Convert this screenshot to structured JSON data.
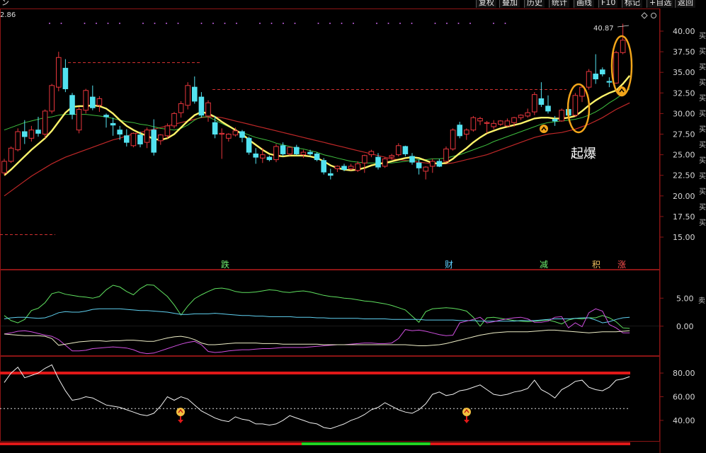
{
  "toolbar": {
    "buttons": [
      "复权",
      "叠加",
      "历史",
      "统计",
      "画线",
      "F10",
      "标记",
      "+自选",
      "返回"
    ],
    "corner_icon": "diamond-icon",
    "truncated_left": "ン"
  },
  "price_readout": "2.86",
  "main_chart": {
    "y_ticks": [
      "40.00",
      "37.50",
      "35.00",
      "32.50",
      "30.00",
      "27.50",
      "25.00",
      "22.50",
      "20.00",
      "17.50",
      "15.00"
    ],
    "high_label": "40.87",
    "annotation": "起爆",
    "signal_labels": [
      {
        "text": "跌",
        "color": "#6fef6f"
      },
      {
        "text": "财",
        "color": "#5fd0ff"
      },
      {
        "text": "减",
        "color": "#6fef6f"
      },
      {
        "text": "积",
        "color": "#f0c060"
      },
      {
        "text": "涨",
        "color": "#ff5050"
      }
    ],
    "right_strip_text": "买买买买买买买买买买买买买"
  },
  "indicator1": {
    "y_ticks": [
      "5.00",
      "0.00"
    ],
    "side_text": "卖"
  },
  "indicator2": {
    "y_ticks": [
      "80.00",
      "60.00",
      "40.00"
    ]
  },
  "colors": {
    "up": "#e8363c",
    "down": "#53e2f0",
    "ma_yellow": "#fff46a",
    "ma_green": "#3fbf3f",
    "ma_red": "#c02828",
    "orange": "#f2a51a",
    "grid": "#8b1515",
    "tick_text": "#d8d8d8"
  },
  "chart_data": {
    "type": "candlestick",
    "y_range": [
      13,
      42
    ],
    "candles": [
      [
        22.8,
        24.5,
        22.5,
        24.2
      ],
      [
        24.2,
        26.0,
        24.0,
        25.8
      ],
      [
        25.6,
        28.2,
        25.4,
        27.8
      ],
      [
        27.8,
        29.2,
        26.3,
        27.2
      ],
      [
        27.0,
        28.5,
        26.6,
        28.0
      ],
      [
        28.0,
        29.6,
        27.2,
        27.6
      ],
      [
        27.5,
        30.5,
        27.0,
        30.3
      ],
      [
        30.3,
        33.6,
        30.0,
        33.4
      ],
      [
        33.2,
        37.5,
        32.7,
        36.8
      ],
      [
        35.5,
        36.6,
        32.6,
        33.0
      ],
      [
        32.2,
        32.5,
        29.3,
        29.9
      ],
      [
        28.0,
        30.8,
        27.6,
        30.5
      ],
      [
        30.4,
        33.0,
        30.0,
        32.8
      ],
      [
        32.0,
        33.4,
        30.4,
        30.7
      ],
      [
        31.0,
        32.1,
        30.2,
        31.8
      ],
      [
        29.8,
        30.0,
        28.3,
        29.6
      ],
      [
        28.8,
        29.5,
        27.3,
        28.6
      ],
      [
        28.0,
        28.5,
        26.8,
        27.5
      ],
      [
        27.3,
        28.1,
        26.0,
        26.5
      ],
      [
        26.1,
        27.7,
        25.9,
        27.6
      ],
      [
        27.4,
        27.8,
        25.9,
        26.3
      ],
      [
        26.5,
        28.3,
        25.8,
        28.0
      ],
      [
        28.0,
        29.3,
        24.9,
        25.3
      ],
      [
        26.7,
        27.5,
        26.2,
        27.4
      ],
      [
        27.3,
        28.8,
        27.0,
        28.5
      ],
      [
        28.5,
        30.2,
        28.2,
        30.0
      ],
      [
        30.1,
        31.5,
        29.5,
        31.2
      ],
      [
        31.0,
        33.8,
        30.5,
        33.4
      ],
      [
        33.2,
        34.5,
        31.2,
        31.5
      ],
      [
        32.0,
        32.6,
        29.5,
        29.8
      ],
      [
        29.7,
        31.6,
        29.0,
        31.3
      ],
      [
        28.9,
        29.7,
        27.0,
        27.5
      ],
      [
        27.5,
        28.2,
        24.5,
        27.6
      ],
      [
        27.0,
        27.6,
        26.6,
        27.5
      ],
      [
        27.4,
        28.3,
        27.2,
        27.9
      ],
      [
        27.8,
        28.0,
        26.5,
        27.1
      ],
      [
        27.0,
        27.2,
        25.0,
        25.3
      ],
      [
        25.1,
        25.8,
        23.9,
        24.7
      ],
      [
        24.6,
        25.8,
        24.0,
        25.0
      ],
      [
        24.7,
        24.9,
        24.2,
        24.4
      ],
      [
        24.4,
        26.3,
        24.1,
        26.0
      ],
      [
        26.1,
        26.5,
        24.8,
        25.1
      ],
      [
        25.1,
        26.0,
        24.9,
        25.9
      ],
      [
        25.9,
        26.2,
        24.9,
        25.1
      ],
      [
        25.0,
        25.6,
        24.6,
        25.3
      ],
      [
        25.3,
        25.6,
        24.8,
        25.1
      ],
      [
        25.1,
        25.3,
        24.2,
        24.4
      ],
      [
        24.3,
        24.6,
        22.6,
        22.9
      ],
      [
        22.7,
        23.3,
        22.0,
        22.5
      ],
      [
        23.3,
        23.7,
        22.9,
        23.6
      ],
      [
        23.6,
        23.9,
        23.0,
        23.2
      ],
      [
        23.3,
        23.9,
        23.1,
        23.6
      ],
      [
        23.1,
        24.2,
        22.9,
        23.9
      ],
      [
        24.0,
        25.0,
        22.8,
        24.9
      ],
      [
        25.0,
        25.6,
        24.7,
        25.4
      ],
      [
        24.7,
        25.2,
        23.2,
        23.5
      ],
      [
        23.6,
        24.7,
        23.4,
        24.5
      ],
      [
        24.7,
        25.1,
        24.4,
        24.9
      ],
      [
        25.0,
        26.4,
        24.8,
        26.1
      ],
      [
        26.0,
        26.1,
        24.8,
        25.1
      ],
      [
        24.8,
        25.2,
        23.8,
        24.1
      ],
      [
        24.0,
        24.4,
        22.6,
        23.4
      ],
      [
        23.0,
        23.6,
        22.0,
        23.5
      ],
      [
        23.6,
        24.5,
        22.8,
        24.2
      ],
      [
        24.2,
        24.5,
        23.5,
        23.6
      ],
      [
        24.2,
        26.0,
        24.0,
        25.7
      ],
      [
        25.7,
        28.2,
        25.5,
        28.0
      ],
      [
        28.6,
        29.0,
        27.0,
        27.3
      ],
      [
        27.5,
        28.2,
        26.8,
        28.0
      ],
      [
        28.0,
        29.7,
        27.8,
        29.5
      ],
      [
        29.1,
        29.6,
        28.6,
        29.4
      ],
      [
        28.8,
        29.1,
        27.6,
        28.9
      ],
      [
        28.4,
        29.2,
        28.1,
        28.8
      ],
      [
        28.7,
        29.2,
        28.5,
        29.1
      ],
      [
        28.5,
        29.4,
        28.4,
        29.1
      ],
      [
        28.9,
        29.6,
        28.4,
        29.5
      ],
      [
        29.5,
        29.9,
        29.2,
        29.8
      ],
      [
        29.7,
        30.6,
        29.5,
        30.1
      ],
      [
        30.2,
        32.6,
        29.8,
        32.3
      ],
      [
        31.8,
        33.8,
        30.8,
        31.1
      ],
      [
        30.9,
        32.2,
        30.0,
        30.3
      ],
      [
        29.3,
        29.7,
        28.5,
        29.1
      ],
      [
        29.1,
        30.6,
        29.0,
        30.4
      ],
      [
        30.5,
        30.9,
        29.6,
        29.8
      ],
      [
        29.8,
        32.5,
        29.6,
        32.2
      ],
      [
        32.1,
        33.5,
        31.4,
        33.2
      ],
      [
        33.2,
        35.4,
        32.9,
        35.1
      ],
      [
        34.8,
        37.2,
        33.6,
        34.2
      ],
      [
        35.3,
        35.6,
        34.5,
        34.8
      ],
      [
        33.9,
        34.4,
        33.2,
        33.8
      ],
      [
        33.7,
        37.6,
        33.6,
        37.4
      ],
      [
        37.4,
        40.9,
        37.2,
        38.9
      ]
    ],
    "ma_fast": [
      22.5,
      23.2,
      24.0,
      24.8,
      25.6,
      26.3,
      27.0,
      27.9,
      29.0,
      30.1,
      30.8,
      30.9,
      30.9,
      31.0,
      30.9,
      30.6,
      30.0,
      29.2,
      28.5,
      28.0,
      27.6,
      27.3,
      26.9,
      26.8,
      27.0,
      27.5,
      28.3,
      29.1,
      29.8,
      30.2,
      30.0,
      29.6,
      29.0,
      28.5,
      28.0,
      27.5,
      26.8,
      26.2,
      25.6,
      25.1,
      24.9,
      24.8,
      24.9,
      24.9,
      24.9,
      24.8,
      24.6,
      24.2,
      23.7,
      23.4,
      23.2,
      23.1,
      23.2,
      23.4,
      23.7,
      23.9,
      24.0,
      24.2,
      24.4,
      24.6,
      24.7,
      24.6,
      24.3,
      24.0,
      23.9,
      24.0,
      24.5,
      25.2,
      25.8,
      26.5,
      27.1,
      27.6,
      27.9,
      28.2,
      28.4,
      28.6,
      28.8,
      29.1,
      29.4,
      29.5,
      29.5,
      29.4,
      29.4,
      29.5,
      29.7,
      30.3,
      31.0,
      31.6,
      32.1,
      32.5,
      32.8,
      33.6,
      34.6
    ],
    "ma_mid": [
      28.0,
      28.3,
      28.6,
      28.9,
      29.1,
      29.3,
      29.5,
      29.6,
      29.8,
      29.9,
      29.9,
      29.9,
      29.9,
      29.8,
      29.7,
      29.6,
      29.4,
      29.2,
      29.0,
      28.9,
      28.7,
      28.6,
      28.4,
      28.2,
      28.1,
      28.0,
      28.2,
      28.6,
      29.2,
      29.6,
      29.6,
      29.2,
      28.8,
      28.4,
      28.0,
      27.7,
      27.4,
      27.1,
      26.9,
      26.7,
      26.4,
      26.2,
      26.0,
      25.8,
      25.7,
      25.5,
      25.3,
      25.0,
      24.8,
      24.6,
      24.4,
      24.2,
      24.1,
      24.0,
      24.0,
      24.0,
      24.0,
      24.0,
      24.1,
      24.2,
      24.3,
      24.4,
      24.4,
      24.5,
      24.5,
      24.6,
      24.8,
      25.0,
      25.3,
      25.6,
      25.9,
      26.2,
      26.6,
      26.9,
      27.2,
      27.5,
      27.8,
      28.1,
      28.4,
      28.7,
      28.9,
      29.0,
      29.1,
      29.2,
      29.3,
      29.5,
      29.8,
      30.2,
      30.7,
      31.3,
      31.8,
      32.4,
      33.0
    ],
    "ma_slow": [
      20.0,
      20.6,
      21.2,
      21.8,
      22.4,
      22.9,
      23.4,
      23.9,
      24.3,
      24.7,
      25.0,
      25.3,
      25.6,
      25.9,
      26.2,
      26.5,
      26.8,
      27.0,
      27.3,
      27.5,
      27.7,
      27.9,
      28.1,
      28.3,
      28.5,
      28.7,
      28.9,
      29.1,
      29.3,
      29.5,
      29.6,
      29.6,
      29.5,
      29.3,
      29.1,
      28.9,
      28.7,
      28.5,
      28.3,
      28.1,
      27.9,
      27.7,
      27.5,
      27.3,
      27.1,
      26.9,
      26.7,
      26.5,
      26.3,
      26.1,
      25.9,
      25.7,
      25.5,
      25.3,
      25.1,
      24.9,
      24.7,
      24.5,
      24.4,
      24.3,
      24.2,
      24.1,
      24.0,
      23.9,
      23.9,
      23.9,
      24.0,
      24.2,
      24.4,
      24.6,
      24.8,
      25.0,
      25.3,
      25.6,
      25.9,
      26.2,
      26.5,
      26.8,
      27.1,
      27.3,
      27.5,
      27.6,
      27.7,
      27.9,
      28.1,
      28.4,
      28.7,
      29.1,
      29.5,
      30.0,
      30.5,
      30.9,
      31.3
    ],
    "ind1": {
      "y_range": [
        -5.2,
        9.2
      ],
      "green": [
        1.9,
        1.0,
        0.6,
        1.2,
        2.8,
        3.2,
        4.2,
        5.8,
        6.1,
        5.7,
        5.5,
        5.3,
        5.2,
        5.0,
        5.3,
        6.5,
        7.3,
        7.0,
        6.2,
        5.6,
        6.7,
        7.4,
        7.3,
        6.3,
        5.3,
        3.8,
        2.0,
        3.6,
        4.9,
        5.6,
        6.2,
        6.7,
        6.8,
        6.6,
        6.2,
        6.0,
        6.0,
        6.1,
        6.3,
        6.5,
        6.4,
        6.1,
        6.0,
        6.2,
        6.3,
        6.1,
        5.8,
        5.5,
        5.3,
        5.2,
        5.0,
        4.9,
        4.7,
        4.5,
        4.4,
        4.2,
        4.0,
        3.7,
        3.3,
        2.9,
        1.8,
        0.7,
        2.6,
        3.1,
        3.2,
        3.3,
        3.2,
        3.0,
        2.7,
        1.6,
        0.0,
        1.5,
        1.6,
        1.4,
        1.2,
        1.0,
        0.9,
        0.8,
        0.9,
        1.0,
        1.1,
        0.8,
        0.4,
        1.1,
        1.4,
        1.3,
        1.5,
        1.5,
        1.9,
        1.5,
        0.8,
        -0.3,
        -0.4
      ],
      "cyan": [
        1.3,
        1.5,
        1.6,
        1.6,
        1.5,
        1.4,
        1.5,
        1.9,
        2.4,
        2.6,
        2.5,
        2.5,
        2.7,
        3.0,
        3.1,
        3.1,
        3.1,
        3.1,
        3.0,
        2.9,
        2.8,
        2.8,
        2.7,
        2.6,
        2.5,
        2.3,
        2.1,
        2.1,
        2.2,
        2.2,
        2.2,
        2.3,
        2.2,
        2.1,
        2.0,
        1.9,
        1.9,
        1.8,
        1.8,
        1.7,
        1.7,
        1.7,
        1.7,
        1.6,
        1.6,
        1.6,
        1.5,
        1.5,
        1.4,
        1.4,
        1.4,
        1.4,
        1.4,
        1.3,
        1.3,
        1.3,
        1.3,
        1.2,
        1.2,
        1.2,
        1.2,
        1.2,
        1.1,
        1.1,
        1.1,
        1.1,
        1.1,
        1.0,
        1.0,
        1.0,
        0.9,
        0.9,
        0.9,
        0.9,
        0.9,
        0.9,
        1.0,
        1.0,
        1.0,
        1.1,
        1.2,
        1.3,
        1.3,
        1.3,
        1.4,
        1.5,
        1.5,
        1.1,
        0.6,
        0.8,
        1.2,
        1.5,
        1.6
      ],
      "magenta": [
        -1.4,
        -1.2,
        -0.9,
        -0.8,
        -1.0,
        -1.3,
        -1.6,
        -1.8,
        -2.4,
        -3.4,
        -4.4,
        -4.4,
        -4.3,
        -4.0,
        -3.9,
        -3.8,
        -3.7,
        -3.8,
        -3.9,
        -4.2,
        -4.7,
        -4.9,
        -4.8,
        -4.4,
        -4.0,
        -3.6,
        -3.2,
        -2.9,
        -2.7,
        -3.3,
        -4.5,
        -4.7,
        -4.6,
        -4.4,
        -4.3,
        -4.2,
        -4.2,
        -4.1,
        -4.0,
        -4.0,
        -3.9,
        -3.8,
        -3.8,
        -3.8,
        -3.8,
        -3.7,
        -3.6,
        -3.5,
        -3.4,
        -3.3,
        -3.3,
        -3.2,
        -3.1,
        -3.0,
        -3.0,
        -3.1,
        -3.1,
        -3.0,
        -2.2,
        -0.6,
        -0.8,
        -0.7,
        -0.9,
        -1.2,
        -1.5,
        -1.7,
        -1.6,
        0.6,
        0.9,
        1.2,
        1.6,
        0.6,
        0.8,
        1.1,
        1.3,
        1.5,
        1.6,
        1.3,
        0.7,
        0.7,
        0.9,
        1.6,
        1.7,
        -0.3,
        0.6,
        -0.1,
        2.4,
        3.1,
        2.7,
        0.3,
        -0.3,
        -1.2,
        -1.2
      ],
      "white": [
        -1.4,
        -1.5,
        -1.6,
        -1.7,
        -1.7,
        -1.7,
        -1.8,
        -2.2,
        -3.4,
        -3.2,
        -3.0,
        -2.8,
        -2.7,
        -2.6,
        -2.6,
        -2.7,
        -2.6,
        -2.6,
        -2.5,
        -2.5,
        -2.6,
        -2.7,
        -2.7,
        -2.4,
        -2.1,
        -1.9,
        -1.8,
        -2.0,
        -2.4,
        -3.0,
        -3.3,
        -3.3,
        -3.2,
        -3.1,
        -3.0,
        -3.0,
        -3.0,
        -3.0,
        -3.1,
        -3.1,
        -3.1,
        -3.2,
        -3.2,
        -3.2,
        -3.2,
        -3.2,
        -3.2,
        -3.3,
        -3.3,
        -3.3,
        -3.3,
        -3.3,
        -3.3,
        -3.3,
        -3.3,
        -3.3,
        -3.3,
        -3.3,
        -3.3,
        -3.3,
        -3.4,
        -3.5,
        -3.5,
        -3.4,
        -3.3,
        -3.1,
        -2.8,
        -2.5,
        -2.2,
        -1.9,
        -1.6,
        -1.4,
        -1.2,
        -1.1,
        -1.0,
        -1.0,
        -1.0,
        -1.0,
        -0.9,
        -0.8,
        -0.7,
        -0.7,
        -0.8,
        -0.9,
        -1.0,
        -1.1,
        -1.2,
        -1.1,
        -1.0,
        -1.0,
        -1.0,
        -0.9,
        -0.8
      ]
    },
    "ind2": {
      "y_range": [
        25,
        92
      ],
      "values": [
        72,
        80,
        85,
        76,
        78,
        80,
        84,
        87,
        75,
        65,
        57,
        58,
        60,
        59,
        56,
        53,
        52,
        51,
        49,
        47,
        45,
        44,
        46,
        52,
        60,
        57,
        60,
        58,
        53,
        48,
        45,
        42,
        40,
        39,
        43,
        41,
        40,
        37,
        37,
        36,
        37,
        40,
        44,
        42,
        40,
        38,
        37,
        34,
        33,
        35,
        37,
        40,
        42,
        45,
        49,
        51,
        55,
        52,
        49,
        47,
        46,
        49,
        54,
        62,
        64,
        61,
        62,
        65,
        66,
        68,
        70,
        66,
        62,
        61,
        62,
        64,
        65,
        67,
        74,
        66,
        63,
        59,
        66,
        69,
        73,
        74,
        68,
        66,
        65,
        68,
        74,
        75,
        77
      ],
      "upper_line": 80,
      "mid_line": 50
    },
    "signals_x": [
      57,
      114,
      163,
      278,
      299
    ],
    "buy_markers_x": [
      95,
      278,
      291
    ],
    "bottom_bar_segments": [
      {
        "start": 0,
        "end": 157,
        "color": "#e01818"
      },
      {
        "start": 157,
        "end": 224,
        "color": "#22d322"
      },
      {
        "start": 224,
        "end": 328,
        "color": "#e01818"
      }
    ]
  }
}
